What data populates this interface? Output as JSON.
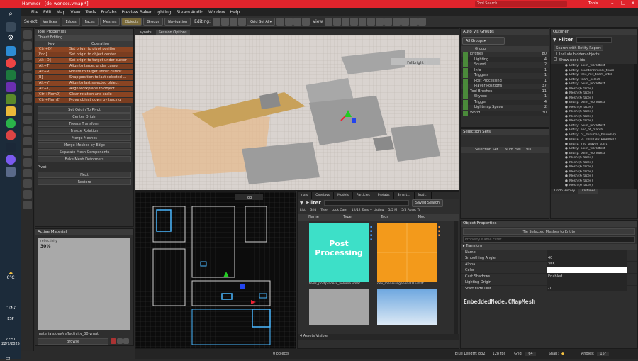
{
  "app": {
    "title": "Hammer - [de_wenecc.vmap *]",
    "search_placeholder": "Tool Search",
    "tools_label": "Tools"
  },
  "menu": [
    "File",
    "Edit",
    "Map",
    "View",
    "Tools",
    "Prefabs",
    "Preview Baked Lighting",
    "Steam Audio",
    "Window",
    "Help"
  ],
  "select_bar": {
    "select_label": "Select",
    "modes": [
      "Vertices",
      "Edges",
      "Faces",
      "Meshes",
      "Objects",
      "Groups",
      "Navigation"
    ],
    "editing_label": "Editing:",
    "editing_value": "Grid Sel All",
    "view_label": "View"
  },
  "tool_properties": {
    "title": "Tool Properties",
    "section": "Object Editing",
    "col_key": "Key",
    "col_op": "Operation",
    "rows": [
      [
        "[Ctrl+D]",
        "Set origin to pivot position"
      ],
      [
        "[End]",
        "Set origin to object center"
      ],
      [
        "[Alt+D]",
        "Set origin to target under cursor"
      ],
      [
        "[Alt+T]",
        "Align to target under cursor"
      ],
      [
        "[Alt+R]",
        "Rotate to target under cursor"
      ],
      [
        "[B]",
        "Snap position to last selected ..."
      ],
      [
        "[Alt+Y]",
        "Align to last selected object"
      ],
      [
        "[Alt+T]",
        "Align workplane to object"
      ],
      [
        "[Ctrl+Num0]",
        "Clear rotation and scale"
      ],
      [
        "[Ctrl+Num2]",
        "Move object down by tracing"
      ]
    ],
    "buttons": [
      "Set Origin To Pivot",
      "Center Origin",
      "Freeze Transform",
      "Freeze Rotation",
      "Merge Meshes",
      "Merge Meshes by Edge",
      "Separate Mesh Components",
      "Bake Mesh Deformers"
    ],
    "pivot_label": "Pivot",
    "next_label": "Next",
    "restore_label": "Restore"
  },
  "active_material": {
    "title": "Active Material",
    "name": "materials/dev/reflectivity_30.vmat",
    "preview_text": "reflectivity",
    "preview_value": "30%",
    "browse": "Browse"
  },
  "viewport_top": {
    "layout_tab": "Layouts",
    "session_tab": "Session Options",
    "mode": "Fullbright"
  },
  "viewport_2d": {
    "mode": "Top"
  },
  "auto_vis": {
    "title": "Auto Vis Groups",
    "dropdown": "All Groups",
    "col_group": "Group",
    "groups": [
      {
        "name": "Entities",
        "count": "80"
      },
      {
        "name": "Lighting",
        "count": "4"
      },
      {
        "name": "Sound",
        "count": "2"
      },
      {
        "name": "Info",
        "count": "1"
      },
      {
        "name": "Triggers",
        "count": "1"
      },
      {
        "name": "Post Processing",
        "count": "1"
      },
      {
        "name": "Player Positions",
        "count": "37"
      },
      {
        "name": "Tool Brushes",
        "count": "11"
      },
      {
        "name": "Skybox",
        "count": "1"
      },
      {
        "name": "Trigger",
        "count": "4"
      },
      {
        "name": "Lightmap Space",
        "count": "2"
      },
      {
        "name": "World",
        "count": "30"
      }
    ]
  },
  "selection_sets": {
    "title": "Selection Sets",
    "cols": [
      "Selection Set",
      "Num",
      "Sel",
      "Vis"
    ]
  },
  "outliner": {
    "title": "Outliner",
    "filter": "Filter",
    "search_button": "Search with Entity Report",
    "include_hidden": "Include hidden objects",
    "show_node_ids": "Show node ids",
    "items": [
      "Entity: point_worldtext",
      "Entity: counterstrikeai_team",
      "Entity: tree_mit_team_intro",
      "Entity: team_select",
      "Entity: point_worldtext",
      "Mesh (6 faces)",
      "Mesh (6 faces)",
      "Mesh (6 faces)",
      "Entity: point_worldtext",
      "Mesh (6 faces)",
      "Mesh (6 faces)",
      "Mesh (6 faces)",
      "Mesh (6 faces)",
      "Entity: point_worldtext",
      "Entity: end_of_match",
      "Entity: cs_minimap_boundary",
      "Entity: cs_minimap_boundary",
      "Entity: info_player_start",
      "Entity: point_worldtext",
      "Entity: point_worldtext",
      "Mesh (6 faces)",
      "Mesh (6 faces)",
      "Mesh (6 faces)",
      "Mesh (6 faces)",
      "Mesh (6 faces)",
      "Mesh (6 faces)",
      "Mesh (6 faces)"
    ],
    "tabs": [
      "Undo History",
      "Outliner"
    ]
  },
  "asset_browser": {
    "tabs": [
      "nais",
      "Overlays",
      "Models",
      "Particles",
      "Prefabs",
      "Smart...",
      "Nod..."
    ],
    "filter": "Filter",
    "saved_search": "Saved Search",
    "opts": [
      "List",
      "Grid",
      "Tree",
      "Lock Cam",
      "12/12 Tags + Listing",
      "5/5 M",
      "5/5 Asset Ty"
    ],
    "cols": [
      "Name",
      "Type",
      "Tags",
      "Mod"
    ],
    "assets": [
      {
        "label": "Post Processing",
        "file": "tools_postprocess_volume.vmat"
      },
      {
        "label": "",
        "file": "dev_measuregeneric01.vmat"
      },
      {
        "label": "",
        "file": ""
      },
      {
        "label": "",
        "file": ""
      }
    ],
    "status": "4 Assets Visible"
  },
  "object_properties": {
    "title": "Object Properties",
    "button": "Tie Selected Meshes to Entity",
    "filter_placeholder": "Property Name Filter",
    "section": "Transform",
    "props": [
      {
        "name": "Name",
        "value": ""
      },
      {
        "name": "Smoothing Angle",
        "value": "40"
      },
      {
        "name": "Alpha",
        "value": "255"
      },
      {
        "name": "Color",
        "value": ""
      },
      {
        "name": "Cast Shadows",
        "value": "Enabled"
      },
      {
        "name": "Lighting Origin",
        "value": ""
      },
      {
        "name": "Start Fade Dist",
        "value": "-1"
      }
    ],
    "class_name": "EmbeddedNode.CMapMesh"
  },
  "status_bar": {
    "objects": "0 objects",
    "blue_length": "Blue Length: 832",
    "units": "128 fps",
    "grid_label": "Grid:",
    "grid_value": "64",
    "snap_label": "Snap:",
    "angles_label": "Angles:",
    "angles_value": "15°"
  },
  "taskbar": {
    "temp": "6°C",
    "language": "ESP",
    "time": "22:51",
    "date": "22/7/2025"
  },
  "colors": {
    "accent_red": "#e0242c",
    "vis_green": "#4a8a3a",
    "asset_cyan": "#3de0c8",
    "asset_orange": "#f39a1b"
  }
}
